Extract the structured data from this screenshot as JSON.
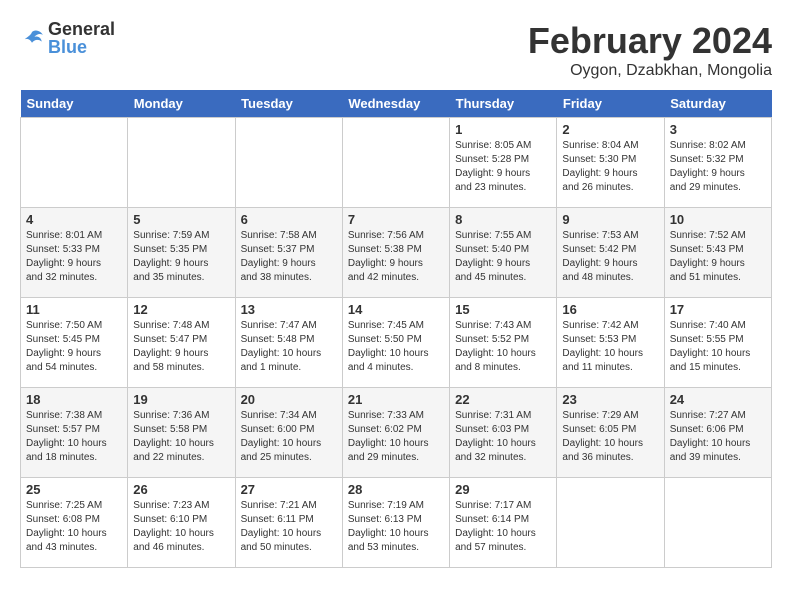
{
  "logo": {
    "general": "General",
    "blue": "Blue"
  },
  "title": "February 2024",
  "location": "Oygon, Dzabkhan, Mongolia",
  "days_of_week": [
    "Sunday",
    "Monday",
    "Tuesday",
    "Wednesday",
    "Thursday",
    "Friday",
    "Saturday"
  ],
  "weeks": [
    [
      {
        "day": "",
        "info": ""
      },
      {
        "day": "",
        "info": ""
      },
      {
        "day": "",
        "info": ""
      },
      {
        "day": "",
        "info": ""
      },
      {
        "day": "1",
        "info": "Sunrise: 8:05 AM\nSunset: 5:28 PM\nDaylight: 9 hours\nand 23 minutes."
      },
      {
        "day": "2",
        "info": "Sunrise: 8:04 AM\nSunset: 5:30 PM\nDaylight: 9 hours\nand 26 minutes."
      },
      {
        "day": "3",
        "info": "Sunrise: 8:02 AM\nSunset: 5:32 PM\nDaylight: 9 hours\nand 29 minutes."
      }
    ],
    [
      {
        "day": "4",
        "info": "Sunrise: 8:01 AM\nSunset: 5:33 PM\nDaylight: 9 hours\nand 32 minutes."
      },
      {
        "day": "5",
        "info": "Sunrise: 7:59 AM\nSunset: 5:35 PM\nDaylight: 9 hours\nand 35 minutes."
      },
      {
        "day": "6",
        "info": "Sunrise: 7:58 AM\nSunset: 5:37 PM\nDaylight: 9 hours\nand 38 minutes."
      },
      {
        "day": "7",
        "info": "Sunrise: 7:56 AM\nSunset: 5:38 PM\nDaylight: 9 hours\nand 42 minutes."
      },
      {
        "day": "8",
        "info": "Sunrise: 7:55 AM\nSunset: 5:40 PM\nDaylight: 9 hours\nand 45 minutes."
      },
      {
        "day": "9",
        "info": "Sunrise: 7:53 AM\nSunset: 5:42 PM\nDaylight: 9 hours\nand 48 minutes."
      },
      {
        "day": "10",
        "info": "Sunrise: 7:52 AM\nSunset: 5:43 PM\nDaylight: 9 hours\nand 51 minutes."
      }
    ],
    [
      {
        "day": "11",
        "info": "Sunrise: 7:50 AM\nSunset: 5:45 PM\nDaylight: 9 hours\nand 54 minutes."
      },
      {
        "day": "12",
        "info": "Sunrise: 7:48 AM\nSunset: 5:47 PM\nDaylight: 9 hours\nand 58 minutes."
      },
      {
        "day": "13",
        "info": "Sunrise: 7:47 AM\nSunset: 5:48 PM\nDaylight: 10 hours\nand 1 minute."
      },
      {
        "day": "14",
        "info": "Sunrise: 7:45 AM\nSunset: 5:50 PM\nDaylight: 10 hours\nand 4 minutes."
      },
      {
        "day": "15",
        "info": "Sunrise: 7:43 AM\nSunset: 5:52 PM\nDaylight: 10 hours\nand 8 minutes."
      },
      {
        "day": "16",
        "info": "Sunrise: 7:42 AM\nSunset: 5:53 PM\nDaylight: 10 hours\nand 11 minutes."
      },
      {
        "day": "17",
        "info": "Sunrise: 7:40 AM\nSunset: 5:55 PM\nDaylight: 10 hours\nand 15 minutes."
      }
    ],
    [
      {
        "day": "18",
        "info": "Sunrise: 7:38 AM\nSunset: 5:57 PM\nDaylight: 10 hours\nand 18 minutes."
      },
      {
        "day": "19",
        "info": "Sunrise: 7:36 AM\nSunset: 5:58 PM\nDaylight: 10 hours\nand 22 minutes."
      },
      {
        "day": "20",
        "info": "Sunrise: 7:34 AM\nSunset: 6:00 PM\nDaylight: 10 hours\nand 25 minutes."
      },
      {
        "day": "21",
        "info": "Sunrise: 7:33 AM\nSunset: 6:02 PM\nDaylight: 10 hours\nand 29 minutes."
      },
      {
        "day": "22",
        "info": "Sunrise: 7:31 AM\nSunset: 6:03 PM\nDaylight: 10 hours\nand 32 minutes."
      },
      {
        "day": "23",
        "info": "Sunrise: 7:29 AM\nSunset: 6:05 PM\nDaylight: 10 hours\nand 36 minutes."
      },
      {
        "day": "24",
        "info": "Sunrise: 7:27 AM\nSunset: 6:06 PM\nDaylight: 10 hours\nand 39 minutes."
      }
    ],
    [
      {
        "day": "25",
        "info": "Sunrise: 7:25 AM\nSunset: 6:08 PM\nDaylight: 10 hours\nand 43 minutes."
      },
      {
        "day": "26",
        "info": "Sunrise: 7:23 AM\nSunset: 6:10 PM\nDaylight: 10 hours\nand 46 minutes."
      },
      {
        "day": "27",
        "info": "Sunrise: 7:21 AM\nSunset: 6:11 PM\nDaylight: 10 hours\nand 50 minutes."
      },
      {
        "day": "28",
        "info": "Sunrise: 7:19 AM\nSunset: 6:13 PM\nDaylight: 10 hours\nand 53 minutes."
      },
      {
        "day": "29",
        "info": "Sunrise: 7:17 AM\nSunset: 6:14 PM\nDaylight: 10 hours\nand 57 minutes."
      },
      {
        "day": "",
        "info": ""
      },
      {
        "day": "",
        "info": ""
      }
    ]
  ]
}
